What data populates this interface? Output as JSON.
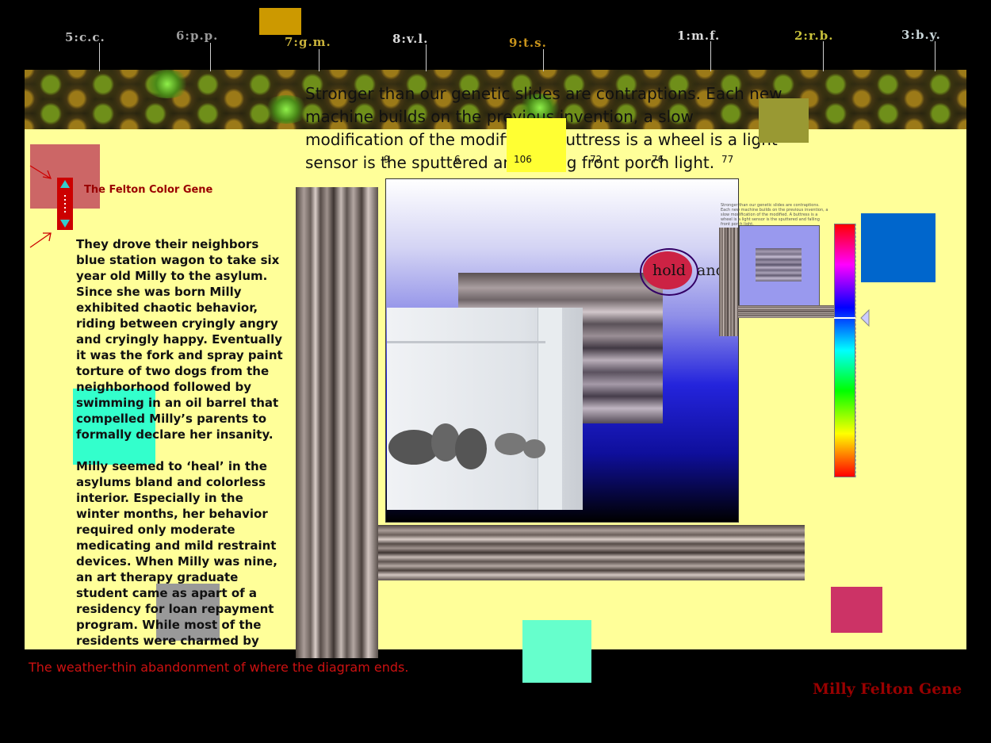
{
  "gene_strip": {
    "loci": [
      {
        "label": "5:c.c.",
        "color": "#bdbdbd"
      },
      {
        "label": "6:p.p.",
        "color": "#9a9a9a"
      },
      {
        "label": "7:g.m.",
        "color": "#c9b23b"
      },
      {
        "label": "8:v.l.",
        "color": "#dcdcdc"
      },
      {
        "label": "9:t.s.",
        "color": "#c9941b"
      },
      {
        "label": "1:m.f.",
        "color": "#dcdcdc"
      },
      {
        "label": "2:r.b.",
        "color": "#c9c23b"
      },
      {
        "label": "3:b.y.",
        "color": "#c9d6d9"
      }
    ]
  },
  "intro_text": "Stronger than our genetic slides are contraptions. Each new machine builds on the previous invention, a slow modification of the modified. A buttress is a wheel is a light sensor is the sputtered and falling front porch light.",
  "numbers": [
    "9",
    "6",
    "106",
    "72",
    "76",
    "77"
  ],
  "title": "The Felton Color Gene",
  "story_paragraphs": [
    "They drove their neighbors blue station wagon to take six year old Milly to the asylum.  Since she was born Milly exhibited chaotic behavior, riding between cryingly angry and cryingly happy. Eventually it was the fork and spray paint torture of two dogs from the neighborhood followed by swimming in an oil barrel that compelled Milly’s parents to formally declare her insanity.",
    "Milly seemed to ‘heal’ in the asylums bland and colorless interior. Especially in the winter months, her behavior required only moderate medicating and mild restraint devices.  When Milly was nine, an art therapy graduate student came as apart of a residency for loan repayment program.  While most of the residents were charmed by tracing drool or"
  ],
  "small_text": "Stronger than our genetic slides are contraptions. Each new machine builds on the previous invention, a slow modification of the modified. A buttress is a wheel is a light sensor is the sputtered and falling front porch light.",
  "hold_label": "hold",
  "and_label": "and",
  "footer_text": "The weather-thin abandonment of where the diagram ends.",
  "signature": "Milly Felton Gene",
  "colors": {
    "panel": "#ffff99",
    "title": "#990000",
    "footer": "#cc1111",
    "signature": "#990000"
  },
  "icons": {
    "scroll_up": "triangle-up-icon",
    "scroll_down": "triangle-down-icon",
    "hue_pointer": "triangle-left-icon"
  }
}
